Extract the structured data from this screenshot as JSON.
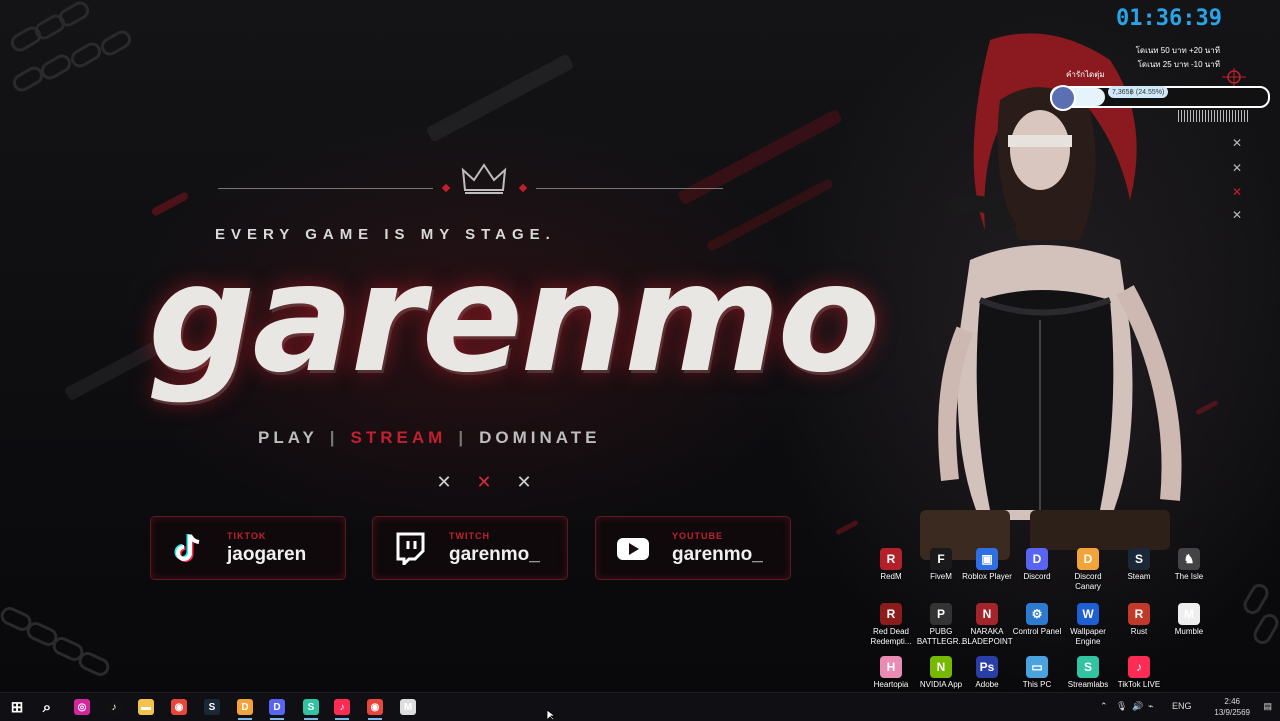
{
  "wallpaper": {
    "tagline": "EVERY GAME IS MY STAGE.",
    "brand": "garenmo",
    "motto": {
      "play": "PLAY",
      "sep1": "|",
      "stream": "STREAM",
      "sep2": "|",
      "dominate": "DOMINATE"
    },
    "socials": [
      {
        "platform": "TIKTOK",
        "handle": "jaogaren",
        "icon": "tiktok-icon"
      },
      {
        "platform": "TWITCH",
        "handle": "garenmo_",
        "icon": "twitch-icon"
      },
      {
        "platform": "YOUTUBE",
        "handle": "garenmo_",
        "icon": "youtube-icon"
      }
    ],
    "accent_color": "#c2202e"
  },
  "overlay": {
    "clock": "01:36:39",
    "donate_rules": [
      "โดเนท 50 บาท +20 นาที",
      "โดเนท 25 บาท -10 นาที"
    ],
    "donor_label": "คำรักไดตุ่ม",
    "goal_text": "7,365฿ (24.55%)",
    "goal_progress": 0.2455,
    "clock_color": "#27a5e8"
  },
  "desktop_icons": [
    {
      "label": "RedM",
      "color": "#b3202a",
      "glyph": "R"
    },
    {
      "label": "FiveM",
      "color": "#1a1a1a",
      "glyph": "F"
    },
    {
      "label": "Roblox Player",
      "color": "#2f6fe4",
      "glyph": "▣"
    },
    {
      "label": "Discord",
      "color": "#5865f2",
      "glyph": "D"
    },
    {
      "label": "Discord Canary",
      "color": "#f2a33a",
      "glyph": "D"
    },
    {
      "label": "Steam",
      "color": "#1b2838",
      "glyph": "S"
    },
    {
      "label": "The Isle",
      "color": "#444",
      "glyph": "♞"
    },
    {
      "label": "Red Dead Redempti...",
      "color": "#8c1c1c",
      "glyph": "R"
    },
    {
      "label": "PUBG BATTLEGR...",
      "color": "#333",
      "glyph": "P"
    },
    {
      "label": "NARAKA BLADEPOINT",
      "color": "#a3242a",
      "glyph": "N"
    },
    {
      "label": "Control Panel",
      "color": "#2d7bd1",
      "glyph": "⚙"
    },
    {
      "label": "Wallpaper Engine",
      "color": "#1e5fd1",
      "glyph": "W"
    },
    {
      "label": "Rust",
      "color": "#c0392b",
      "glyph": "R"
    },
    {
      "label": "Mumble",
      "color": "#eee",
      "glyph": "M"
    },
    {
      "label": "Heartopia",
      "color": "#e98bb5",
      "glyph": "H"
    },
    {
      "label": "NVIDIA App",
      "color": "#76b900",
      "glyph": "N"
    },
    {
      "label": "Adobe",
      "color": "#2a3ea8",
      "glyph": "Ps"
    },
    {
      "label": "This PC",
      "color": "#4aa3df",
      "glyph": "▭"
    },
    {
      "label": "Streamlabs",
      "color": "#31c3a2",
      "glyph": "S"
    },
    {
      "label": "TikTok LIVE",
      "color": "#fe2c55",
      "glyph": "♪"
    }
  ],
  "taskbar": {
    "apps": [
      {
        "name": "start-button",
        "glyph": "⊞",
        "color": "transparent"
      },
      {
        "name": "search-button",
        "glyph": "⌕",
        "color": "transparent"
      },
      {
        "name": "instagram-app",
        "glyph": "◎",
        "color": "#d6249f"
      },
      {
        "name": "tiktok-app",
        "glyph": "♪",
        "color": "#111"
      },
      {
        "name": "file-explorer-app",
        "glyph": "▬",
        "color": "#f2c14e"
      },
      {
        "name": "chrome-app",
        "glyph": "◉",
        "color": "#e8453c"
      },
      {
        "name": "steam-app",
        "glyph": "S",
        "color": "#1b2838"
      },
      {
        "name": "discord-canary-app",
        "glyph": "D",
        "color": "#f2a33a"
      },
      {
        "name": "discord-app",
        "glyph": "D",
        "color": "#5865f2"
      },
      {
        "name": "streamlabs-app",
        "glyph": "S",
        "color": "#31c3a2"
      },
      {
        "name": "tiktok-live-app",
        "glyph": "♪",
        "color": "#fe2c55"
      },
      {
        "name": "chrome-profile-app",
        "glyph": "◉",
        "color": "#e8453c"
      },
      {
        "name": "mumble-app",
        "glyph": "M",
        "color": "#ddd"
      }
    ],
    "language": "ENG",
    "time": "2:46",
    "date": "13/9/2569"
  }
}
